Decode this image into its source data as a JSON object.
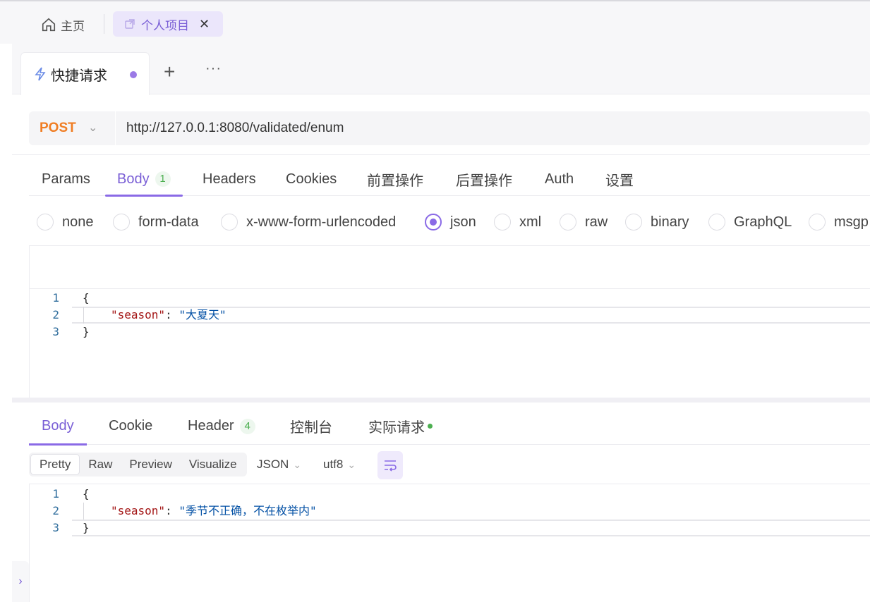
{
  "topnav": {
    "home_label": "主页",
    "project_tab_label": "个人项目",
    "project_tab_close": "✕"
  },
  "request_tabs": {
    "active_tab_label": "快捷请求",
    "add_label": "+",
    "more_label": "···"
  },
  "urlbar": {
    "method": "POST",
    "method_color": "#f07d23",
    "url": "http://127.0.0.1:8080/validated/enum"
  },
  "request_section_tabs": [
    {
      "label": "Params"
    },
    {
      "label": "Body",
      "badge": "1",
      "active": true
    },
    {
      "label": "Headers"
    },
    {
      "label": "Cookies"
    },
    {
      "label": "前置操作"
    },
    {
      "label": "后置操作"
    },
    {
      "label": "Auth"
    },
    {
      "label": "设置"
    }
  ],
  "body_types": [
    {
      "label": "none"
    },
    {
      "label": "form-data"
    },
    {
      "label": "x-www-form-urlencoded"
    },
    {
      "label": "json",
      "selected": true
    },
    {
      "label": "xml"
    },
    {
      "label": "raw"
    },
    {
      "label": "binary"
    },
    {
      "label": "GraphQL"
    },
    {
      "label": "msgp"
    }
  ],
  "request_body": {
    "line_numbers": [
      "1",
      "2",
      "3"
    ],
    "open_brace": "{",
    "key": "\"season\"",
    "colon": ": ",
    "value": "\"大夏天\"",
    "close_brace": "}"
  },
  "response_tabs": [
    {
      "label": "Body",
      "active": true
    },
    {
      "label": "Cookie"
    },
    {
      "label": "Header",
      "badge": "4"
    },
    {
      "label": "控制台"
    },
    {
      "label": "实际请求",
      "status_dot": "green"
    }
  ],
  "response_tools": {
    "views": [
      "Pretty",
      "Raw",
      "Preview",
      "Visualize"
    ],
    "active_view": "Pretty",
    "format": "JSON",
    "encoding": "utf8",
    "wrap_icon": "word-wrap-icon"
  },
  "response_body": {
    "line_numbers": [
      "1",
      "2",
      "3"
    ],
    "open_brace": "{",
    "key": "\"season\"",
    "colon": ": ",
    "value": "\"季节不正确，不在枚举内\"",
    "close_brace": "}"
  },
  "colors": {
    "accent": "#8a6ae6",
    "method_post": "#f07d23",
    "badge_green": "#4caf50"
  }
}
